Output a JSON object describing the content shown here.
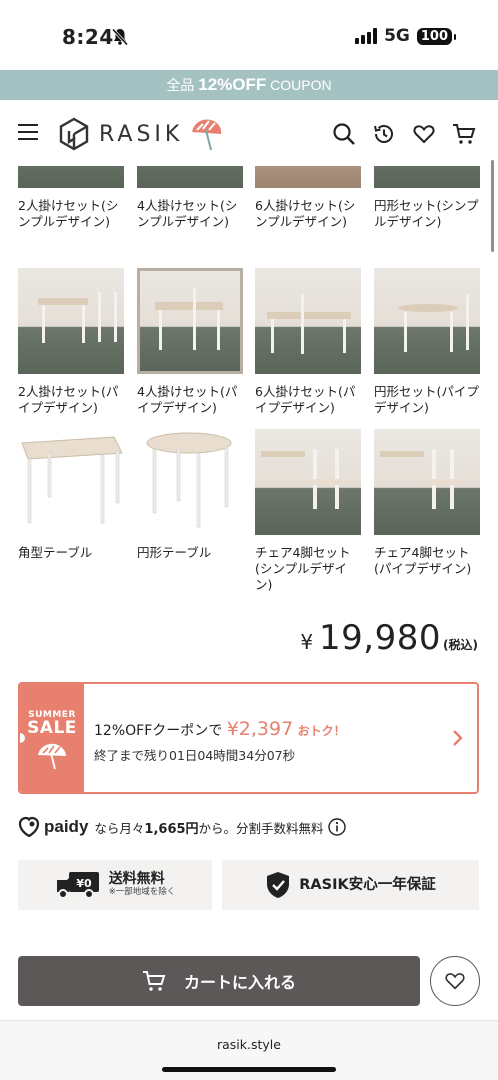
{
  "status": {
    "time": "8:24",
    "network": "5G",
    "battery": "100"
  },
  "coupon_banner": {
    "prefix": "全品",
    "percent": "12%OFF",
    "suffix": "COUPON"
  },
  "header": {
    "logo_text": "RASIK"
  },
  "grid": {
    "row1": [
      {
        "label": "2人掛けセット(シンプルデザイン)"
      },
      {
        "label": "4人掛けセット(シンプルデザイン)"
      },
      {
        "label": "6人掛けセット(シンプルデザイン)"
      },
      {
        "label": "円形セット(シンプルデザイン)"
      }
    ],
    "row2": [
      {
        "label": "2人掛けセット(パイプデザイン)"
      },
      {
        "label": "4人掛けセット(パイプデザイン)"
      },
      {
        "label": "6人掛けセット(パイプデザイン)"
      },
      {
        "label": "円形セット(パイプデザイン)"
      }
    ],
    "row3": [
      {
        "label": "角型テーブル"
      },
      {
        "label": "円形テーブル"
      },
      {
        "label": "チェア4脚セット(シンプルデザイン)"
      },
      {
        "label": "チェア4脚セット(パイプデザイン)"
      }
    ],
    "selected_item": "4人掛けセット(パイプデザイン)"
  },
  "price": {
    "currency": "¥",
    "amount": "19,980",
    "tax_note": "(税込)"
  },
  "sale": {
    "badge_top": "SUMMER",
    "badge_main": "SALE",
    "coupon_text": "12%OFFクーポンで",
    "discount_amount": "¥2,397",
    "discount_suffix": "おトク！",
    "countdown": "終了まで残り01日04時間34分07秒"
  },
  "paidy": {
    "brand": "paidy",
    "text_prefix": "なら月々",
    "monthly_amount": "1,665円",
    "text_suffix": "から。分割手数料無料"
  },
  "features": {
    "shipping_title": "送料無料",
    "shipping_note": "※一部地域を除く",
    "shipping_badge": "¥0",
    "warranty": "RASIK安心一年保証"
  },
  "cart": {
    "label": "カートに入れる"
  },
  "browser": {
    "url": "rasik.style"
  },
  "colors": {
    "banner": "#a5c2c3",
    "sale_accent": "#e8806f",
    "cart_button": "#5b5857"
  }
}
